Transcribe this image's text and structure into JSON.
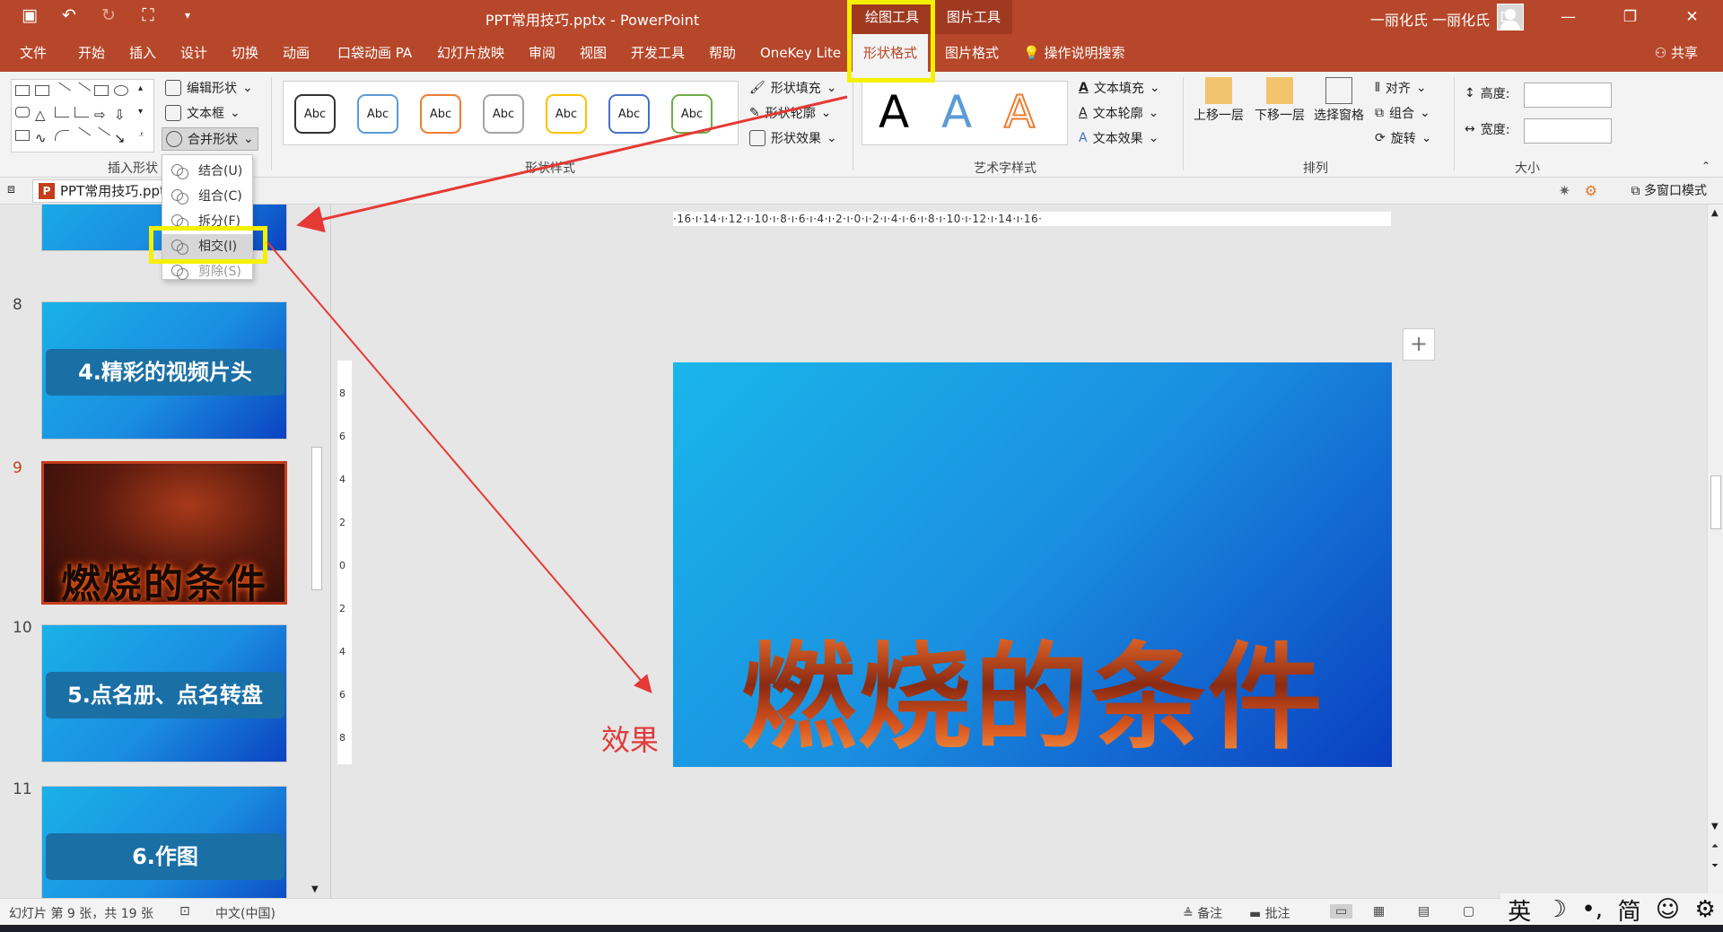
{
  "titlebar": {
    "document_title": "PPT常用技巧.pptx  -  PowerPoint",
    "contextual_drawing_tools": "绘图工具",
    "contextual_picture_tools": "图片工具",
    "user_name": "一丽化氏 一丽化氏"
  },
  "tabs": {
    "file": "文件",
    "home": "开始",
    "insert": "插入",
    "design": "设计",
    "transitions": "切换",
    "animations": "动画",
    "pocket_animation": "口袋动画 PA",
    "slideshow": "幻灯片放映",
    "review": "审阅",
    "view": "视图",
    "developer": "开发工具",
    "help": "帮助",
    "onekey": "OneKey Lite",
    "shape_format": "形状格式",
    "picture_format": "图片格式",
    "tell_me": "操作说明搜索",
    "share": "共享"
  },
  "ribbon": {
    "edit_shape": "编辑形状",
    "text_box": "文本框",
    "merge_shapes": "合并形状",
    "insert_shapes_label": "插入形状",
    "shape_styles_label": "形状样式",
    "style_chip_text": "Abc",
    "shape_fill": "形状填充",
    "shape_outline": "形状轮廓",
    "shape_effects": "形状效果",
    "wordart_letter": "A",
    "wordart_label": "艺术字样式",
    "text_fill": "文本填充",
    "text_outline": "文本轮廓",
    "text_effects": "文本效果",
    "bring_forward": "上移一层",
    "send_backward": "下移一层",
    "selection_pane": "选择窗格",
    "align": "对齐",
    "group": "组合",
    "rotate": "旋转",
    "arrange_label": "排列",
    "height_label": "高度:",
    "width_label": "宽度:",
    "size_label": "大小"
  },
  "merge_menu": {
    "union": "结合(U)",
    "combine": "组合(C)",
    "fragment": "拆分(F)",
    "intersect": "相交(I)",
    "subtract": "剪除(S)"
  },
  "document_tab": {
    "name": "PPT常用技巧.pptx",
    "multi_window": "多窗口模式"
  },
  "thumbnails": [
    {
      "number": "8",
      "title": "4.精彩的视频片头"
    },
    {
      "number": "9",
      "title": "燃烧的条件"
    },
    {
      "number": "10",
      "title": "5.点名册、点名转盘"
    },
    {
      "number": "11",
      "title": "6.作图"
    }
  ],
  "ruler": {
    "horizontal": "·16·ı·14·ı·12·ı·10·ı·8·ı·6·ı·4·ı·2·ı·0·ı·2·ı·4·ı·6·ı·8·ı·10·ı·12·ı·14·ı·16·",
    "vertical_ticks": [
      "8",
      "6",
      "4",
      "2",
      "0",
      "2",
      "4",
      "6",
      "8"
    ]
  },
  "slide": {
    "title": "燃烧的条件",
    "add_button": "+"
  },
  "annotation": {
    "effect_label": "效果",
    "arrow_color": "#e53935",
    "highlight_color": "#f4f000"
  },
  "status": {
    "slide_info": "幻灯片 第 9 张，共 19 张",
    "language": "中文(中国)",
    "notes": "备注",
    "comments": "批注"
  },
  "ime": {
    "mode": "英",
    "moon": "☽",
    "punct": "•,",
    "simplified": "简",
    "emoji": "☺",
    "settings": "⚙"
  },
  "colors": {
    "accent": "#b7472a",
    "ribbon_bg": "#f3f3f3"
  }
}
